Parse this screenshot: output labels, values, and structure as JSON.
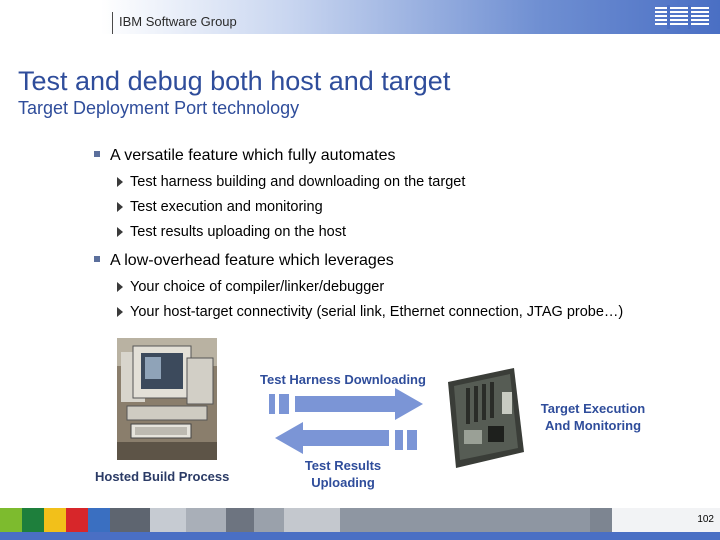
{
  "header": {
    "group_label": "IBM Software Group",
    "logo_text": "IBM"
  },
  "slide": {
    "title": "Test and debug both host and target",
    "subtitle": "Target Deployment Port technology"
  },
  "bullets": [
    {
      "text": "A versatile feature which fully automates",
      "subitems": [
        "Test harness building and downloading on the target",
        "Test execution and monitoring",
        "Test results uploading on the host"
      ]
    },
    {
      "text": "A low-overhead feature which leverages",
      "subitems": [
        "Your choice of compiler/linker/debugger",
        "Your host-target connectivity (serial link, Ethernet connection, JTAG probe…)"
      ]
    }
  ],
  "diagram": {
    "downloading_label": "Test Harness Downloading",
    "execution_label_1": "Target Execution",
    "execution_label_2": "And Monitoring",
    "results_label_1": "Test Results",
    "results_label_2": "Uploading",
    "host_label": "Hosted Build Process"
  },
  "colors": {
    "title_blue": "#2f4d9b",
    "arrow_blue": "#7b95d6",
    "footer_gray": "#8e96a2",
    "brand_blue": "#4a6fc4"
  },
  "footer": {
    "page_number": "102"
  }
}
